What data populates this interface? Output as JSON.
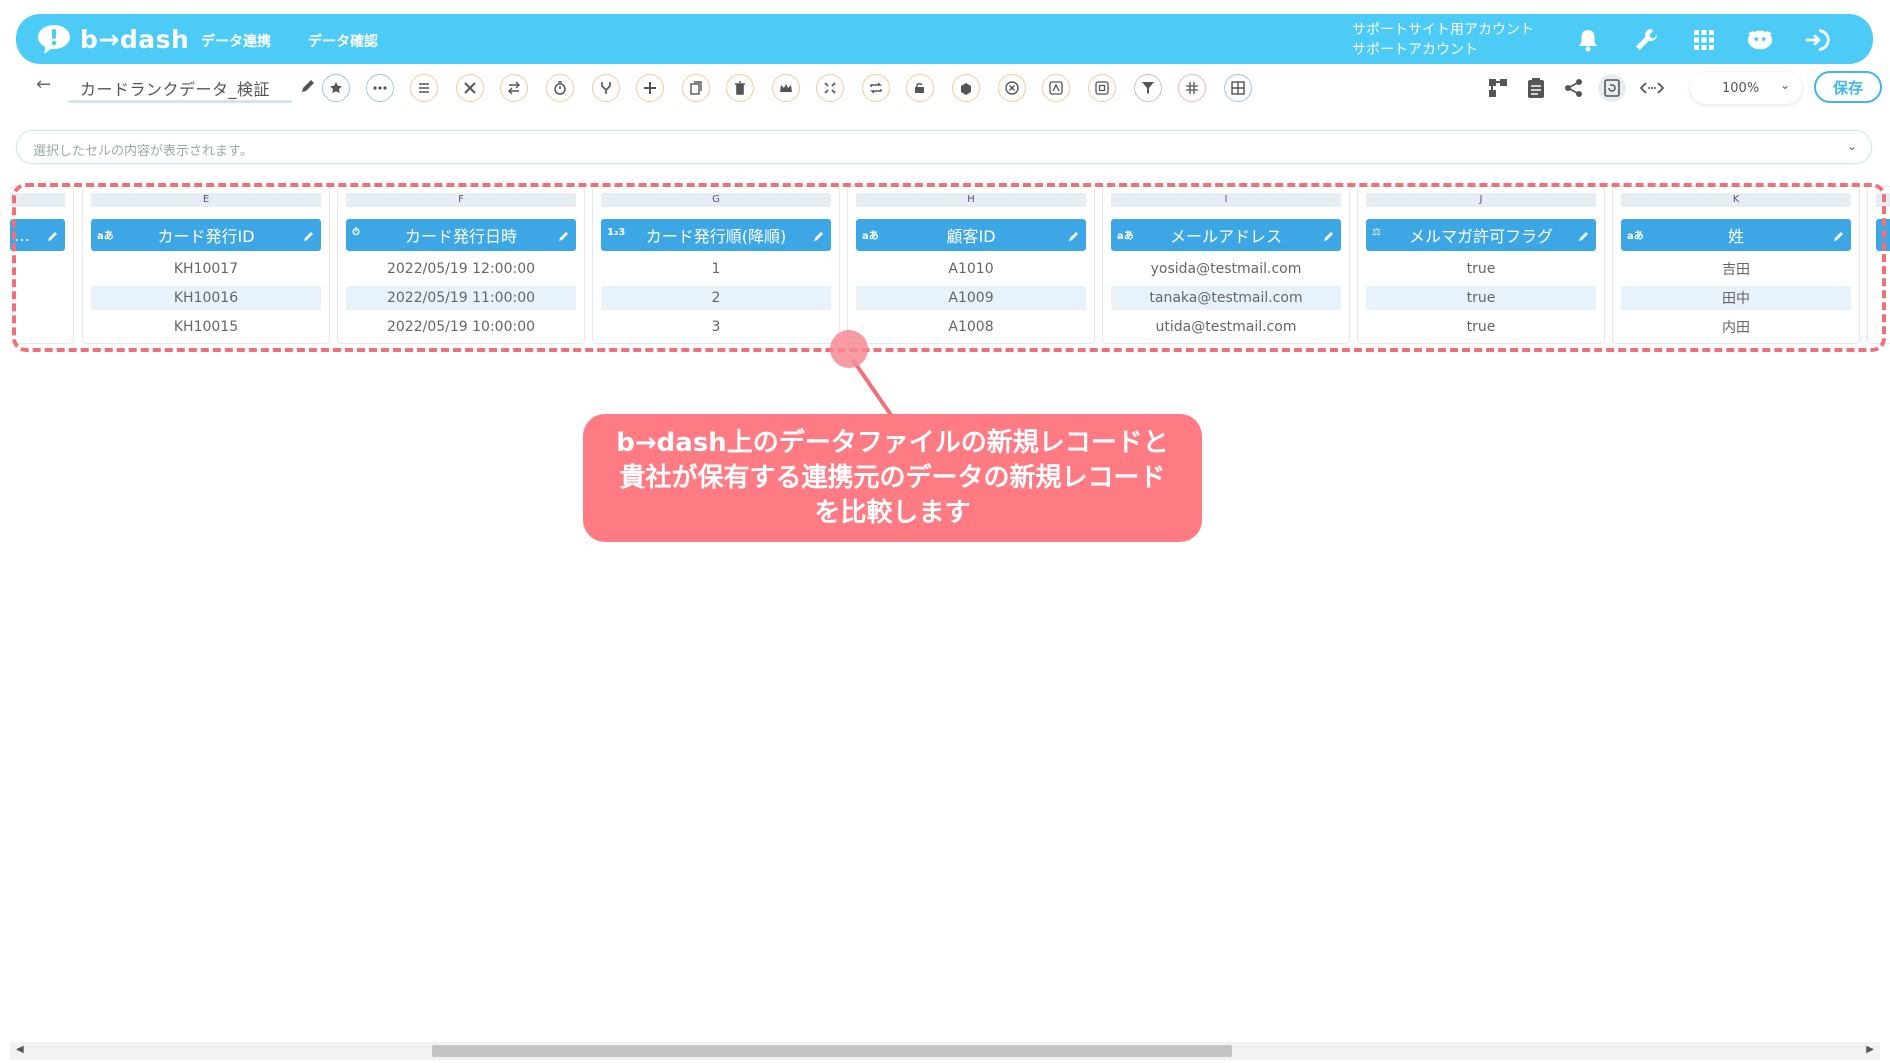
{
  "header": {
    "logo_text": "b→dash",
    "nav": [
      "データ連携",
      "データ確認"
    ],
    "account_line1": "サポートサイト用アカウント",
    "account_line2": "サポートアカウント"
  },
  "toolbar": {
    "file_title": "カードランクデータ_検証",
    "zoom": "100%",
    "save_label": "保存"
  },
  "cellbar": {
    "placeholder": "選択したセルの内容が表示されます。"
  },
  "partial_column": {
    "label": "…"
  },
  "columns": [
    {
      "letter": "E",
      "type": "aあ",
      "name": "カード発行ID",
      "cells": [
        "KH10017",
        "KH10016",
        "KH10015"
      ]
    },
    {
      "letter": "F",
      "type": "⏱",
      "name": "カード発行日時",
      "cells": [
        "2022/05/19 12:00:00",
        "2022/05/19 11:00:00",
        "2022/05/19 10:00:00"
      ]
    },
    {
      "letter": "G",
      "type": "1₂3",
      "name": "カード発行順(降順)",
      "cells": [
        "1",
        "2",
        "3"
      ]
    },
    {
      "letter": "H",
      "type": "aあ",
      "name": "顧客ID",
      "cells": [
        "A1010",
        "A1009",
        "A1008"
      ]
    },
    {
      "letter": "I",
      "type": "aあ",
      "name": "メールアドレス",
      "cells": [
        "yosida@testmail.com",
        "tanaka@testmail.com",
        "utida@testmail.com"
      ]
    },
    {
      "letter": "J",
      "type": "⚖",
      "name": "メルマガ許可フラグ",
      "cells": [
        "true",
        "true",
        "true"
      ]
    },
    {
      "letter": "K",
      "type": "aあ",
      "name": "姓",
      "cells": [
        "吉田",
        "田中",
        "内田"
      ]
    }
  ],
  "callout": {
    "line1": "b→dash上のデータファイルの新規レコードと",
    "line2": "貴社が保有する連携元のデータの新規レコード",
    "line3": "を比較します"
  },
  "colors": {
    "header_bg": "#4ccbf7",
    "column_header_bg": "#3da7e6",
    "highlight": "#f0707a",
    "callout_bg": "#ff7b84"
  }
}
